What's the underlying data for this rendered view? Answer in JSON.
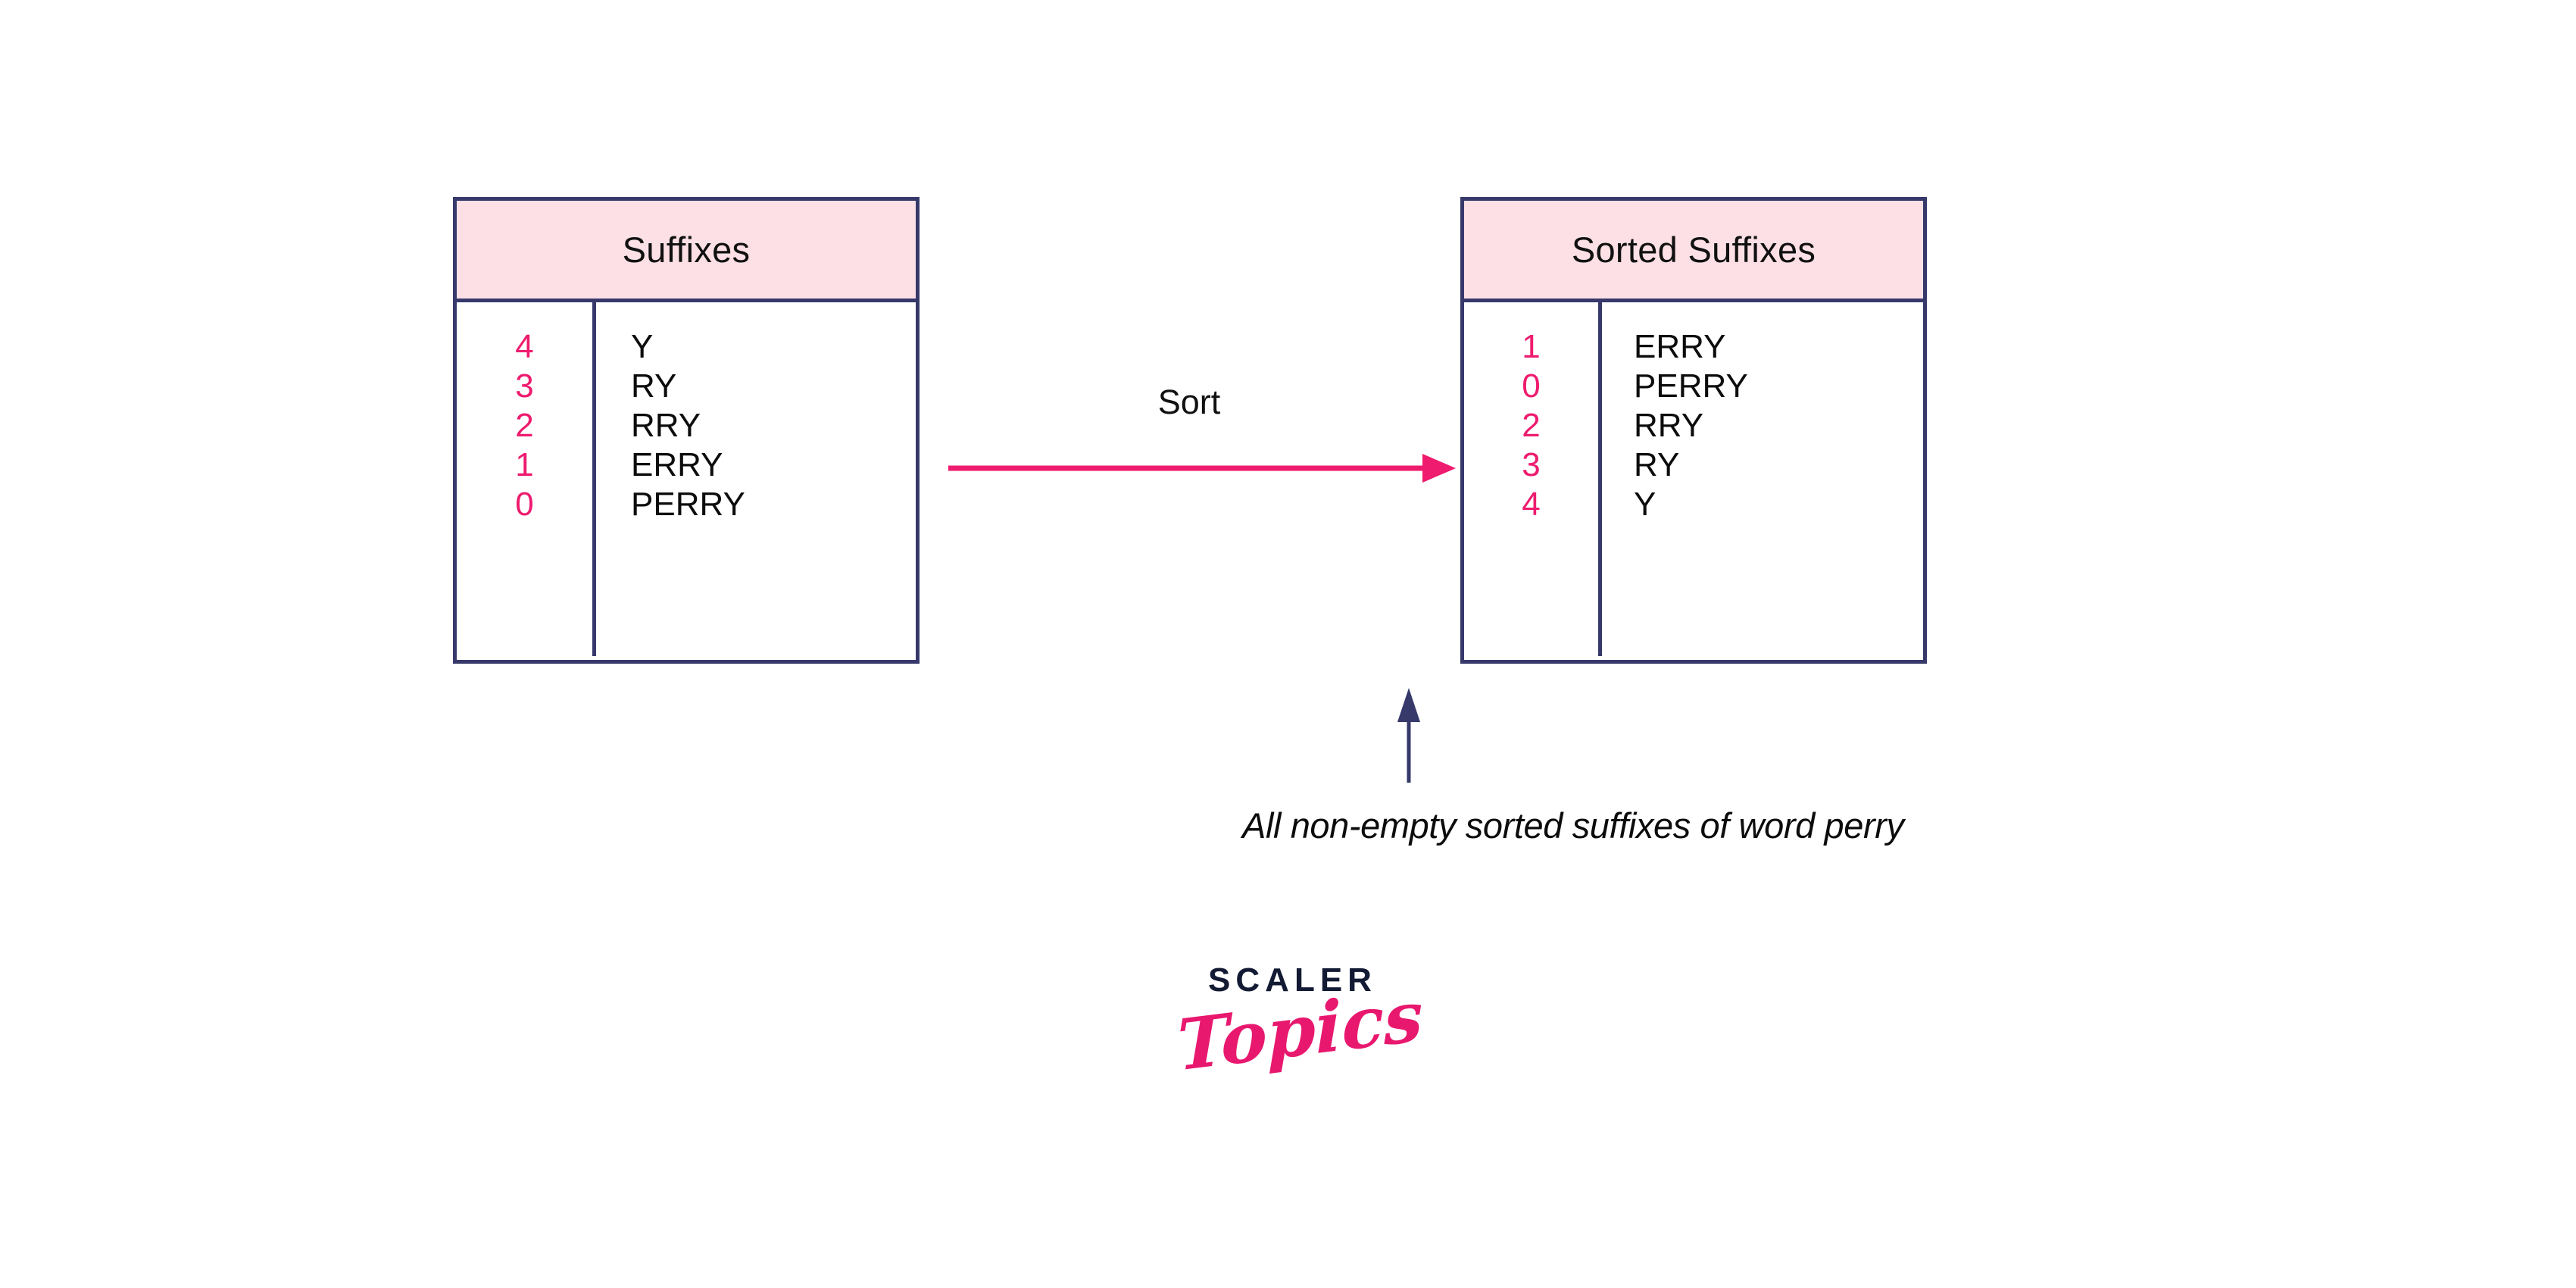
{
  "background_color": "#ffffff",
  "colors": {
    "border_navy": "#37396b",
    "header_pink": "#fce0e6",
    "accent_magenta": "#ee1b6e",
    "text_black": "#0c0c0c",
    "logo_navy": "#131a33",
    "logo_pink": "#e8186f"
  },
  "tables": {
    "left": {
      "title": "Suffixes",
      "columns": [
        "index",
        "suffix"
      ],
      "rows": [
        {
          "index": "4",
          "suffix": "Y"
        },
        {
          "index": "3",
          "suffix": "RY"
        },
        {
          "index": "2",
          "suffix": "RRY"
        },
        {
          "index": "1",
          "suffix": "ERRY"
        },
        {
          "index": "0",
          "suffix": "PERRY"
        }
      ]
    },
    "right": {
      "title": "Sorted Suffixes",
      "columns": [
        "index",
        "suffix"
      ],
      "rows": [
        {
          "index": "1",
          "suffix": "ERRY"
        },
        {
          "index": "0",
          "suffix": "PERRY"
        },
        {
          "index": "2",
          "suffix": "RRY"
        },
        {
          "index": "3",
          "suffix": "RY"
        },
        {
          "index": "4",
          "suffix": "Y"
        }
      ]
    }
  },
  "transition": {
    "label": "Sort",
    "arrow_icon": "right-arrow-icon",
    "arrow_color": "#ee1b6e"
  },
  "annotation": {
    "text": "All non-empty sorted suffixes of word perry",
    "pointer_icon": "up-arrow-icon",
    "pointer_color": "#37396b"
  },
  "logo": {
    "wordmark": "SCALER",
    "script": "Topics"
  }
}
